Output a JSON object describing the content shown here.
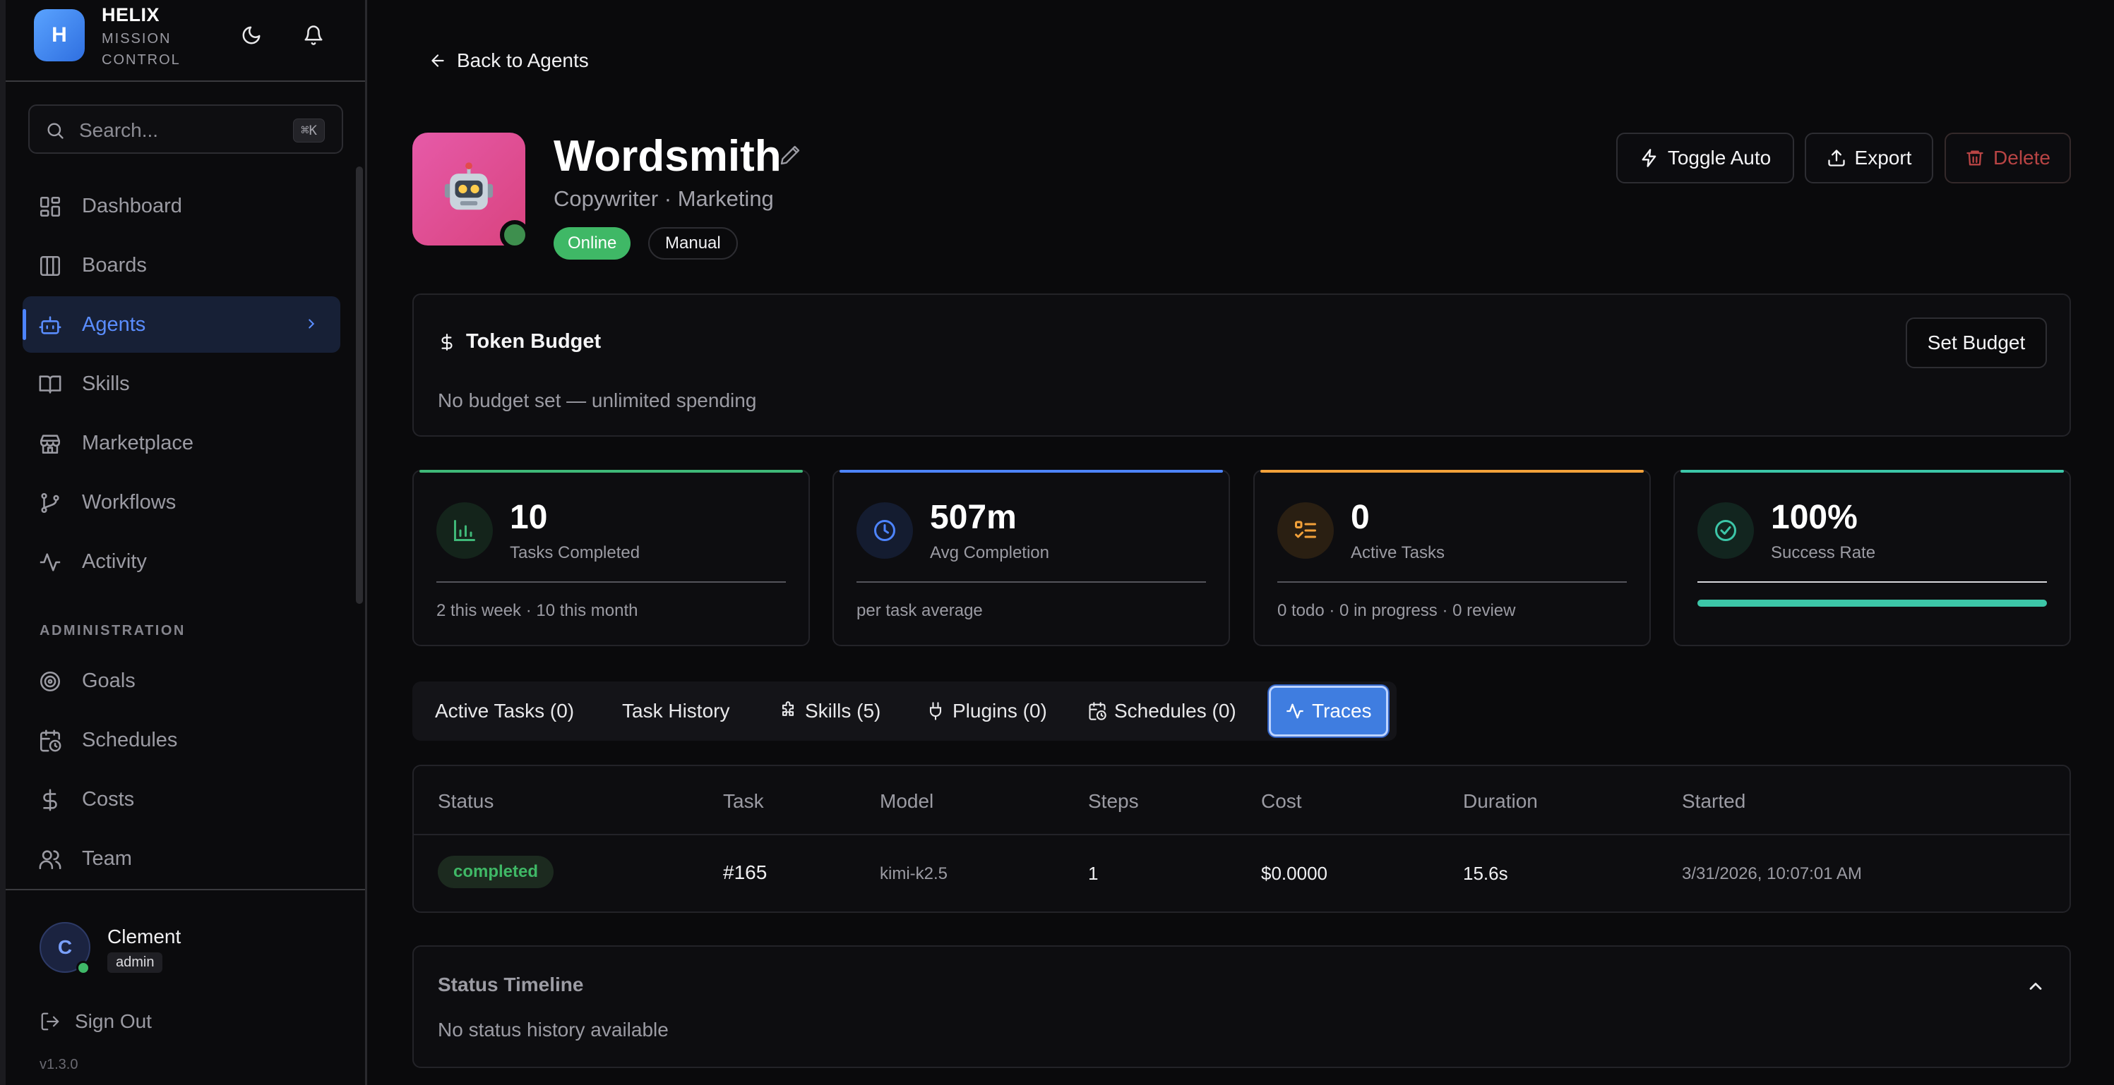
{
  "brand": {
    "logo_letter": "H",
    "name": "HELIX",
    "sub1": "MISSION",
    "sub2": "CONTROL"
  },
  "search": {
    "placeholder": "Search...",
    "shortcut": "⌘K"
  },
  "nav": {
    "items": [
      {
        "label": "Dashboard",
        "icon": "dashboard-icon"
      },
      {
        "label": "Boards",
        "icon": "boards-icon"
      },
      {
        "label": "Agents",
        "icon": "bot-icon",
        "active": true
      },
      {
        "label": "Skills",
        "icon": "book-icon"
      },
      {
        "label": "Marketplace",
        "icon": "store-icon"
      },
      {
        "label": "Workflows",
        "icon": "git-branch-icon"
      },
      {
        "label": "Activity",
        "icon": "activity-icon"
      }
    ],
    "section_label": "ADMINISTRATION",
    "admin_items": [
      {
        "label": "Goals",
        "icon": "target-icon"
      },
      {
        "label": "Schedules",
        "icon": "calendar-clock-icon"
      },
      {
        "label": "Costs",
        "icon": "dollar-icon"
      },
      {
        "label": "Team",
        "icon": "users-icon"
      }
    ]
  },
  "user": {
    "initial": "C",
    "name": "Clement",
    "role": "admin",
    "signout": "Sign Out",
    "version": "v1.3.0"
  },
  "page": {
    "back_label": "Back to Agents",
    "agent": {
      "name": "Wordsmith",
      "subtitle": "Copywriter · Marketing",
      "status": "Online",
      "mode": "Manual",
      "emoji": "🤖"
    },
    "actions": {
      "toggle": "Toggle Auto",
      "export": "Export",
      "delete": "Delete"
    }
  },
  "budget": {
    "title": "Token Budget",
    "description": "No budget set — unlimited spending",
    "button": "Set Budget"
  },
  "stats": [
    {
      "value": "10",
      "label": "Tasks Completed",
      "footer": "2 this week · 10 this month",
      "accent": "#3fb878"
    },
    {
      "value": "507m",
      "label": "Avg Completion",
      "footer": "per task average",
      "accent": "#4d84ff"
    },
    {
      "value": "0",
      "label": "Active Tasks",
      "footer": "0 todo · 0 in progress · 0 review",
      "accent": "#f2a13a"
    },
    {
      "value": "100%",
      "label": "Success Rate",
      "progress": 1.0,
      "accent": "#3cc6a8"
    }
  ],
  "tabs": [
    {
      "label": "Active Tasks (0)"
    },
    {
      "label": "Task History"
    },
    {
      "label": "Skills (5)",
      "icon": "puzzle-icon"
    },
    {
      "label": "Plugins (0)",
      "icon": "plug-icon"
    },
    {
      "label": "Schedules (0)",
      "icon": "calendar-clock-icon"
    },
    {
      "label": "Traces",
      "icon": "activity-icon",
      "active": true
    }
  ],
  "traces": {
    "columns": [
      "Status",
      "Task",
      "Model",
      "Steps",
      "Cost",
      "Duration",
      "Started"
    ],
    "rows": [
      {
        "status": "completed",
        "task": "#165",
        "model": "kimi-k2.5",
        "steps": "1",
        "cost": "$0.0000",
        "duration": "15.6s",
        "started": "3/31/2026, 10:07:01 AM"
      }
    ]
  },
  "timeline": {
    "title": "Status Timeline",
    "description": "No status history available"
  }
}
